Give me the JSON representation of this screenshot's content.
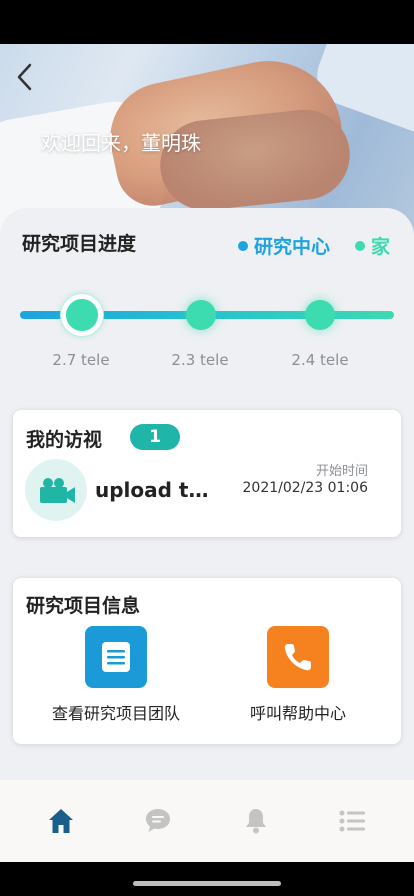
{
  "header": {
    "welcome_text": "欢迎回来，董明珠"
  },
  "progress": {
    "title": "研究项目进度",
    "legend": [
      {
        "label": "研究中心",
        "color": "#1ea3df"
      },
      {
        "label": "家",
        "color": "#3ddab0"
      }
    ],
    "steps": [
      {
        "label": "2.7 tele",
        "active": true
      },
      {
        "label": "2.3 tele",
        "active": false
      },
      {
        "label": "2.4 tele",
        "active": false
      }
    ]
  },
  "visits": {
    "title": "我的访视",
    "count": "1",
    "item": {
      "title": "upload t…",
      "time_label": "开始时间",
      "time": "2021/02/23 01:06",
      "icon": "video-camera-icon"
    }
  },
  "info": {
    "title": "研究项目信息",
    "actions": [
      {
        "label": "查看研究项目团队",
        "icon": "document-icon",
        "color": "#1a9ad6"
      },
      {
        "label": "呼叫帮助中心",
        "icon": "phone-icon",
        "color": "#f5821f"
      }
    ]
  },
  "nav": {
    "items": [
      {
        "icon": "home-icon",
        "active": true
      },
      {
        "icon": "chat-icon",
        "active": false
      },
      {
        "icon": "bell-icon",
        "active": false
      },
      {
        "icon": "list-icon",
        "active": false
      }
    ],
    "active_color": "#1a5f8c",
    "inactive_color": "#c4c4c4"
  }
}
